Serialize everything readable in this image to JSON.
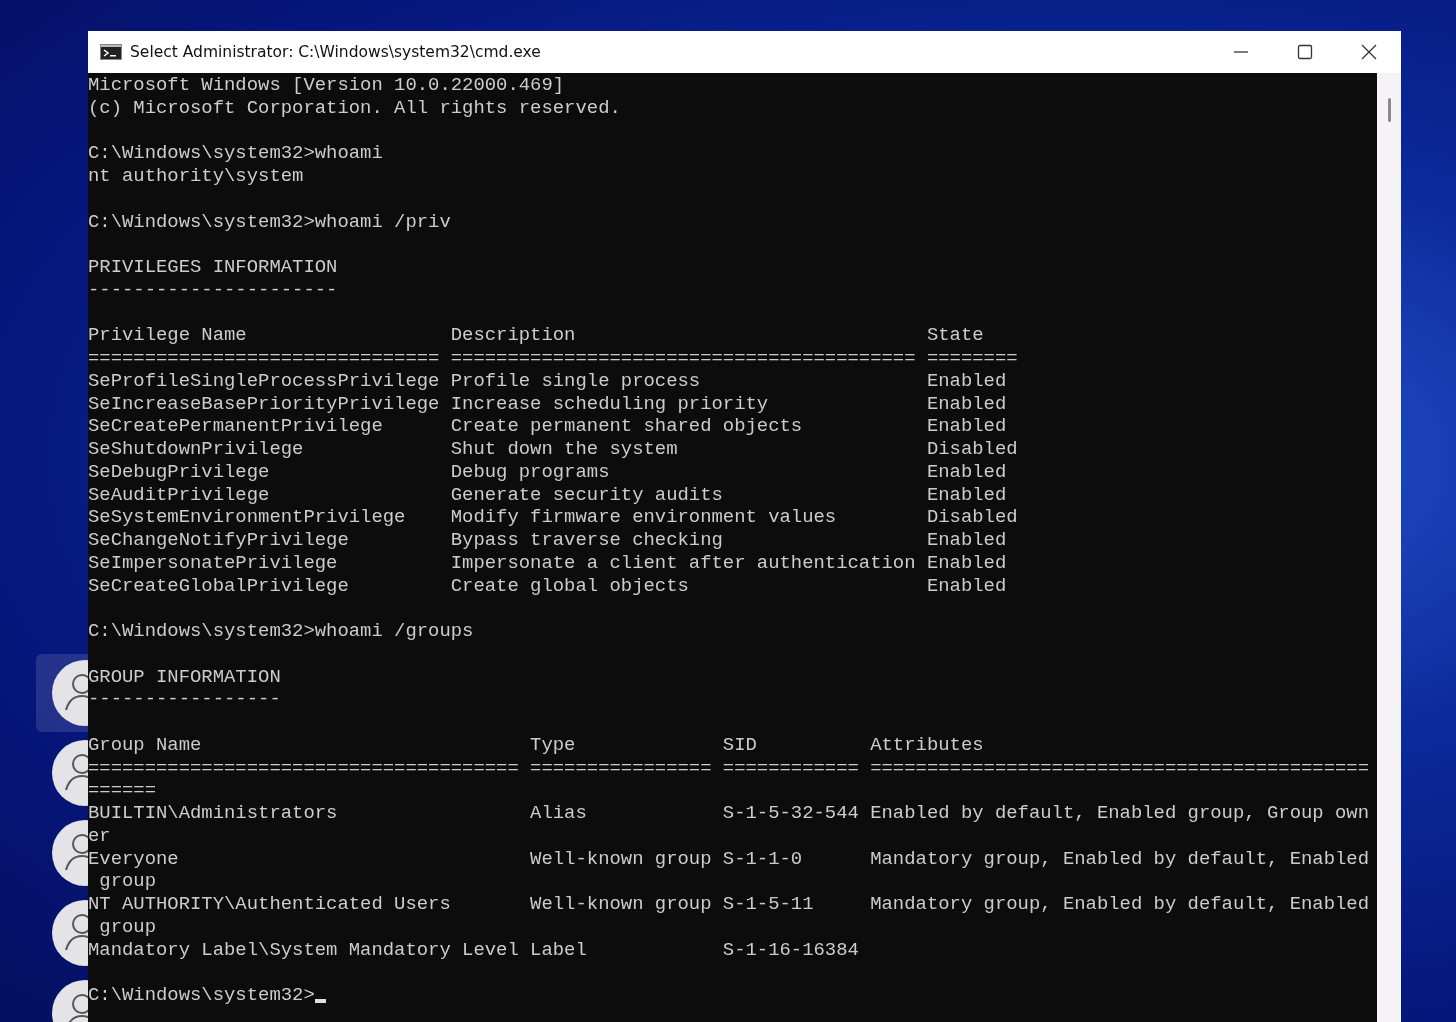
{
  "desktop": {
    "user_tiles": [
      {
        "selected": true
      },
      {
        "selected": false
      },
      {
        "selected": false
      },
      {
        "selected": false
      },
      {
        "selected": false
      }
    ]
  },
  "window": {
    "title": "Select Administrator: C:\\Windows\\system32\\cmd.exe"
  },
  "console": {
    "cursor": true,
    "blocks": [
      [
        "Microsoft Windows [Version 10.0.22000.469]",
        "(c) Microsoft Corporation. All rights reserved."
      ],
      [
        "C:\\Windows\\system32>whoami",
        "nt authority\\system"
      ],
      [
        "C:\\Windows\\system32>whoami /priv"
      ],
      [
        "PRIVILEGES INFORMATION",
        "----------------------"
      ],
      [
        "Privilege Name                  Description                               State",
        "=============================== ========================================= ========",
        "SeProfileSingleProcessPrivilege Profile single process                    Enabled",
        "SeIncreaseBasePriorityPrivilege Increase scheduling priority              Enabled",
        "SeCreatePermanentPrivilege      Create permanent shared objects           Enabled",
        "SeShutdownPrivilege             Shut down the system                      Disabled",
        "SeDebugPrivilege                Debug programs                            Enabled",
        "SeAuditPrivilege                Generate security audits                  Enabled",
        "SeSystemEnvironmentPrivilege    Modify firmware environment values        Disabled",
        "SeChangeNotifyPrivilege         Bypass traverse checking                  Enabled",
        "SeImpersonatePrivilege          Impersonate a client after authentication Enabled",
        "SeCreateGlobalPrivilege         Create global objects                     Enabled"
      ],
      [
        "C:\\Windows\\system32>whoami /groups"
      ],
      [
        "GROUP INFORMATION",
        "-----------------"
      ],
      [
        "Group Name                             Type             SID          Attributes",
        "====================================== ================ ============ ============================================",
        "======",
        "BUILTIN\\Administrators                 Alias            S-1-5-32-544 Enabled by default, Enabled group, Group own",
        "er",
        "Everyone                               Well-known group S-1-1-0      Mandatory group, Enabled by default, Enabled",
        " group",
        "NT AUTHORITY\\Authenticated Users       Well-known group S-1-5-11     Mandatory group, Enabled by default, Enabled",
        " group",
        "Mandatory Label\\System Mandatory Level Label            S-1-16-16384"
      ],
      [
        "C:\\Windows\\system32>"
      ]
    ]
  }
}
